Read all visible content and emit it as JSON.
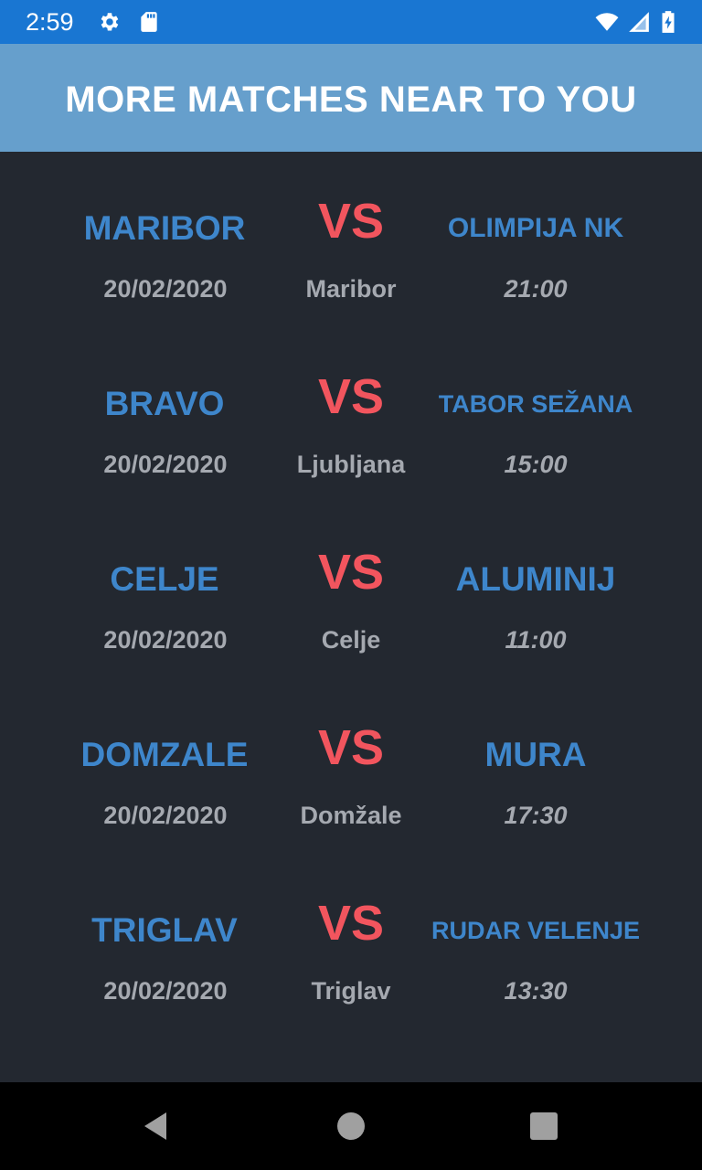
{
  "status_bar": {
    "time": "2:59",
    "icons": [
      "gear-icon",
      "sd-card-icon",
      "wifi-icon",
      "cell-signal-icon",
      "battery-charging-icon"
    ]
  },
  "header": {
    "title": "MORE MATCHES NEAR TO YOU",
    "color": "#669fcc"
  },
  "colors": {
    "team": "#3e86cb",
    "vs": "#f2555e",
    "info": "#a5a9b0",
    "background": "#232830"
  },
  "matches": [
    {
      "home": "MARIBOR",
      "vs": "VS",
      "away": "OLIMPIJA NK",
      "date": "20/02/2020",
      "venue": "Maribor",
      "time": "21:00"
    },
    {
      "home": "BRAVO",
      "vs": "VS",
      "away": "TABOR SEŽANA",
      "date": "20/02/2020",
      "venue": "Ljubljana",
      "time": "15:00"
    },
    {
      "home": "CELJE",
      "vs": "VS",
      "away": "ALUMINIJ",
      "date": "20/02/2020",
      "venue": "Celje",
      "time": "11:00"
    },
    {
      "home": "DOMZALE",
      "vs": "VS",
      "away": "MURA",
      "date": "20/02/2020",
      "venue": "Domžale",
      "time": "17:30"
    },
    {
      "home": "TRIGLAV",
      "vs": "VS",
      "away": "RUDAR VELENJE",
      "date": "20/02/2020",
      "venue": "Triglav",
      "time": "13:30"
    }
  ],
  "nav_bar": {
    "icons": [
      "back-icon",
      "home-icon",
      "recents-icon"
    ]
  }
}
